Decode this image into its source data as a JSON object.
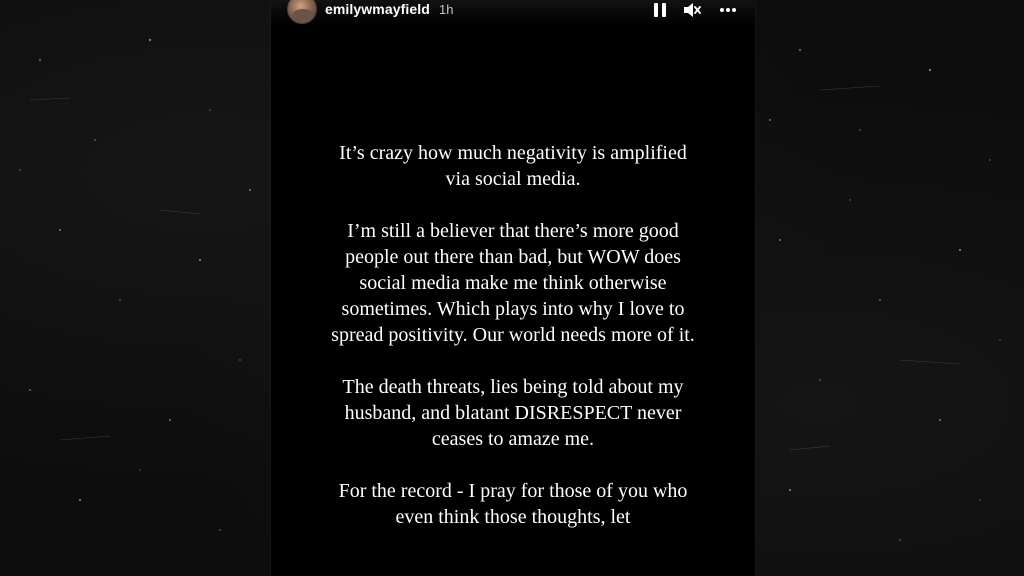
{
  "story": {
    "username": "emilywmayfield",
    "timestamp": "1h",
    "paragraphs": [
      "It’s crazy how much negativity is amplified via social media.",
      "I’m still a believer that there’s more good people out there than bad, but WOW does social media make me think otherwise sometimes. Which plays into why I love to spread positivity. Our world needs more of it.",
      "The death threats, lies being told about my husband, and blatant DISRESPECT never ceases to amaze me.",
      "For the record - I pray for those of you who even think those thoughts, let"
    ]
  },
  "controls": {
    "pause_icon": "pause-icon",
    "mute_icon": "mute-icon",
    "more_icon": "more-icon"
  },
  "colors": {
    "background": "#0d0d0d",
    "story_background": "#000000",
    "text": "#ffffff"
  }
}
